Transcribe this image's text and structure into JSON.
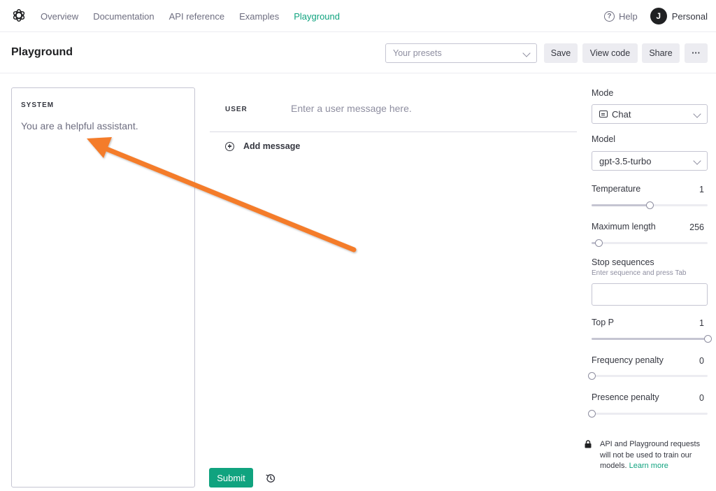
{
  "nav": {
    "logo_icon": "openai-logo-icon",
    "links": [
      "Overview",
      "Documentation",
      "API reference",
      "Examples",
      "Playground"
    ],
    "active": "Playground",
    "help": "Help",
    "account_initial": "J",
    "account_name": "Personal"
  },
  "header": {
    "title": "Playground",
    "presets_placeholder": "Your presets",
    "save": "Save",
    "view_code": "View code",
    "share": "Share",
    "more": "···"
  },
  "system": {
    "label": "SYSTEM",
    "text": "You are a helpful assistant."
  },
  "chat": {
    "user_label": "USER",
    "user_placeholder": "Enter a user message here.",
    "add_message": "Add message",
    "submit": "Submit"
  },
  "settings": {
    "mode_label": "Mode",
    "mode_value": "Chat",
    "model_label": "Model",
    "model_value": "gpt-3.5-turbo",
    "temperature_label": "Temperature",
    "temperature_value": "1",
    "temperature_level": 0.5,
    "max_length_label": "Maximum length",
    "max_length_value": "256",
    "max_length_level": 0.06,
    "stop_label": "Stop sequences",
    "stop_hint": "Enter sequence and press Tab",
    "top_p_label": "Top P",
    "top_p_value": "1",
    "top_p_level": 1.0,
    "freq_label": "Frequency penalty",
    "freq_value": "0",
    "freq_level": 0,
    "presence_label": "Presence penalty",
    "presence_value": "0",
    "presence_level": 0
  },
  "notice": {
    "text": "API and Playground requests will not be used to train our models.",
    "link": "Learn more"
  },
  "colors": {
    "accent": "#10a37f",
    "annotation_arrow": "#f47c2c"
  }
}
